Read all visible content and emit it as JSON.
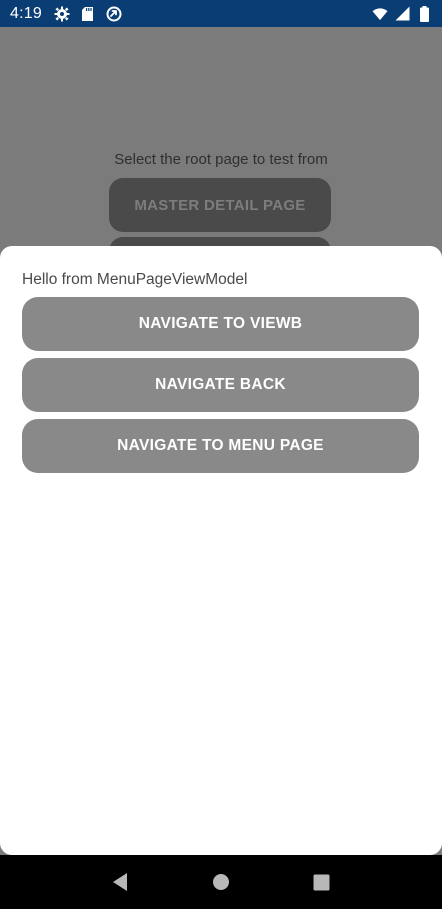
{
  "status_bar": {
    "time": "4:19",
    "left_icons": [
      "gear-icon",
      "sd-card-icon",
      "sync-icon"
    ],
    "right_icons": [
      "wifi-icon",
      "signal-icon",
      "battery-icon"
    ],
    "background": "#0a3d73"
  },
  "base_page": {
    "instruction": "Select the root page to test from",
    "buttons": [
      {
        "label": "MASTER DETAIL PAGE"
      },
      {
        "label": ""
      }
    ]
  },
  "sheet": {
    "title": "Hello from MenuPageViewModel",
    "buttons": [
      {
        "label": "NAVIGATE TO VIEWB"
      },
      {
        "label": "NAVIGATE BACK"
      },
      {
        "label": "NAVIGATE TO MENU PAGE"
      }
    ]
  },
  "nav_bar": {
    "buttons": [
      "back-icon",
      "home-icon",
      "recents-icon"
    ]
  },
  "colors": {
    "scrim": "#7b7b7b",
    "sheet_button": "#898989",
    "sheet_background": "#ffffff"
  }
}
